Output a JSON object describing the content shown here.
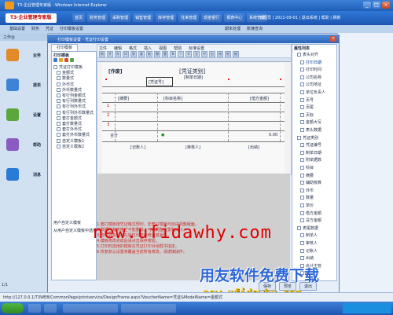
{
  "window": {
    "title": "T3-企业管理专家版 - Windows Internet Explorer",
    "min": "_",
    "max": "□",
    "close": "×"
  },
  "app": {
    "logo": "T3·企业管理专家版",
    "main_menu": [
      "首页",
      "财务管理",
      "采购管理",
      "销售管理",
      "库存管理",
      "往来管理",
      "现金银行",
      "报表中心",
      "系统管理"
    ],
    "status_text": "管理员 | 2011-09-01 | 退出系统 | 帮助 | 刷新"
  },
  "subbar": {
    "tabs": [
      "基础设置",
      "财务",
      "凭证",
      "打印模板设置"
    ],
    "right_items": [
      "期末处理",
      "账簿查询"
    ]
  },
  "left_nav": {
    "header": "工作台",
    "items": [
      {
        "label": "业务",
        "color": "#e08a2a"
      },
      {
        "label": "报表",
        "color": "#3f83d6"
      },
      {
        "label": "设置",
        "color": "#5aa83c"
      },
      {
        "label": "帮助",
        "color": "#8a5cc2"
      },
      {
        "label": "消息",
        "color": "#2a7ad8"
      }
    ],
    "page_indicator": "1/1"
  },
  "dialog": {
    "title": "打印模板设置 - 凭证打印设置",
    "close": "×",
    "tab": "打印模板",
    "left_panel": {
      "title": "打印模板",
      "tree": [
        "凭证打印模板",
        "金额式",
        "数量式",
        "外币式",
        "外币数量式",
        "有行列金额式",
        "有行列数量式",
        "有行列外币式",
        "有行列外币数量式",
        "套打金额式",
        "套打数量式",
        "套打外币式",
        "套打外币数量式",
        "自定义模板1",
        "自定义模板2"
      ],
      "footer": [
        "用户自定义模板",
        "从用户自定义模板中选择模板"
      ]
    },
    "toolbar_menu": [
      "文件",
      "编辑",
      "格式",
      "插入",
      "视图",
      "帮助",
      "标准设置"
    ],
    "toolbar_tools": [
      "新",
      "开",
      "存",
      "印",
      "剪",
      "复",
      "粘",
      "撤",
      "重",
      "B",
      "I",
      "U",
      "左",
      "中",
      "右",
      "线",
      "框",
      "缩"
    ],
    "voucher": {
      "corner_label": "[作废]",
      "title": "[凭证类别]",
      "subtitle": "[制单日期]",
      "voucher_no": "[凭证号]",
      "col_summary": "[摘要]",
      "col_account": "[科目名称]",
      "col_amount": "[借方金额]",
      "col_amount2": "[贷方金额]",
      "total": "合计",
      "total_value": "0.00",
      "footer_left": "[记账人]",
      "footer_mid": "[审核人]",
      "footer_right": "[出纳]",
      "row_numbers": [
        "1",
        "2",
        "3",
        "4"
      ]
    },
    "properties": {
      "title": "属性列表",
      "items": [
        "表头对齐",
        "打印日期",
        "打印时间",
        "公司名称",
        "公司地址",
        "单位负责人",
        "页号",
        "页尾",
        "页标",
        "金额大写",
        "表头数据",
        "凭证类别",
        "凭证编号",
        "制单日期",
        "附单据数",
        "科目",
        "摘要",
        "辅助核算",
        "外币",
        "数量",
        "单价",
        "借方金额",
        "贷方金额",
        "表尾数据",
        "制单人",
        "审核人",
        "记账人",
        "出纳",
        "会计主管",
        "经办人"
      ],
      "selected_index": 1
    },
    "notes": [
      "1.套打模板按凭证格式预印，非套打模板可自由调整版面。",
      "2.数据栏和表格栏不能删除，可以调整位置和大小。",
      "3.选中对象后可在属性列表中修改其属性。",
      "4.模板修改完成后请点击保存按钮。",
      "5.打印时选用的模板在凭证打印对话框中指定。",
      "6.恢复默认设置将覆盖当前所有修改，请谨慎操作。"
    ],
    "buttons": [
      "保存",
      "预览",
      "退出"
    ]
  },
  "watermarks": {
    "main": "new.ufidawhy.com",
    "cn": "用友软件免费下载",
    "bottom": "new.ufidawhy.com"
  },
  "statusbar": {
    "text": "http://127.0.0.1/T3WEB/CommonPage/printservice/DesignFrame.aspx?VoucherName=凭证&ModelName=金额式"
  }
}
